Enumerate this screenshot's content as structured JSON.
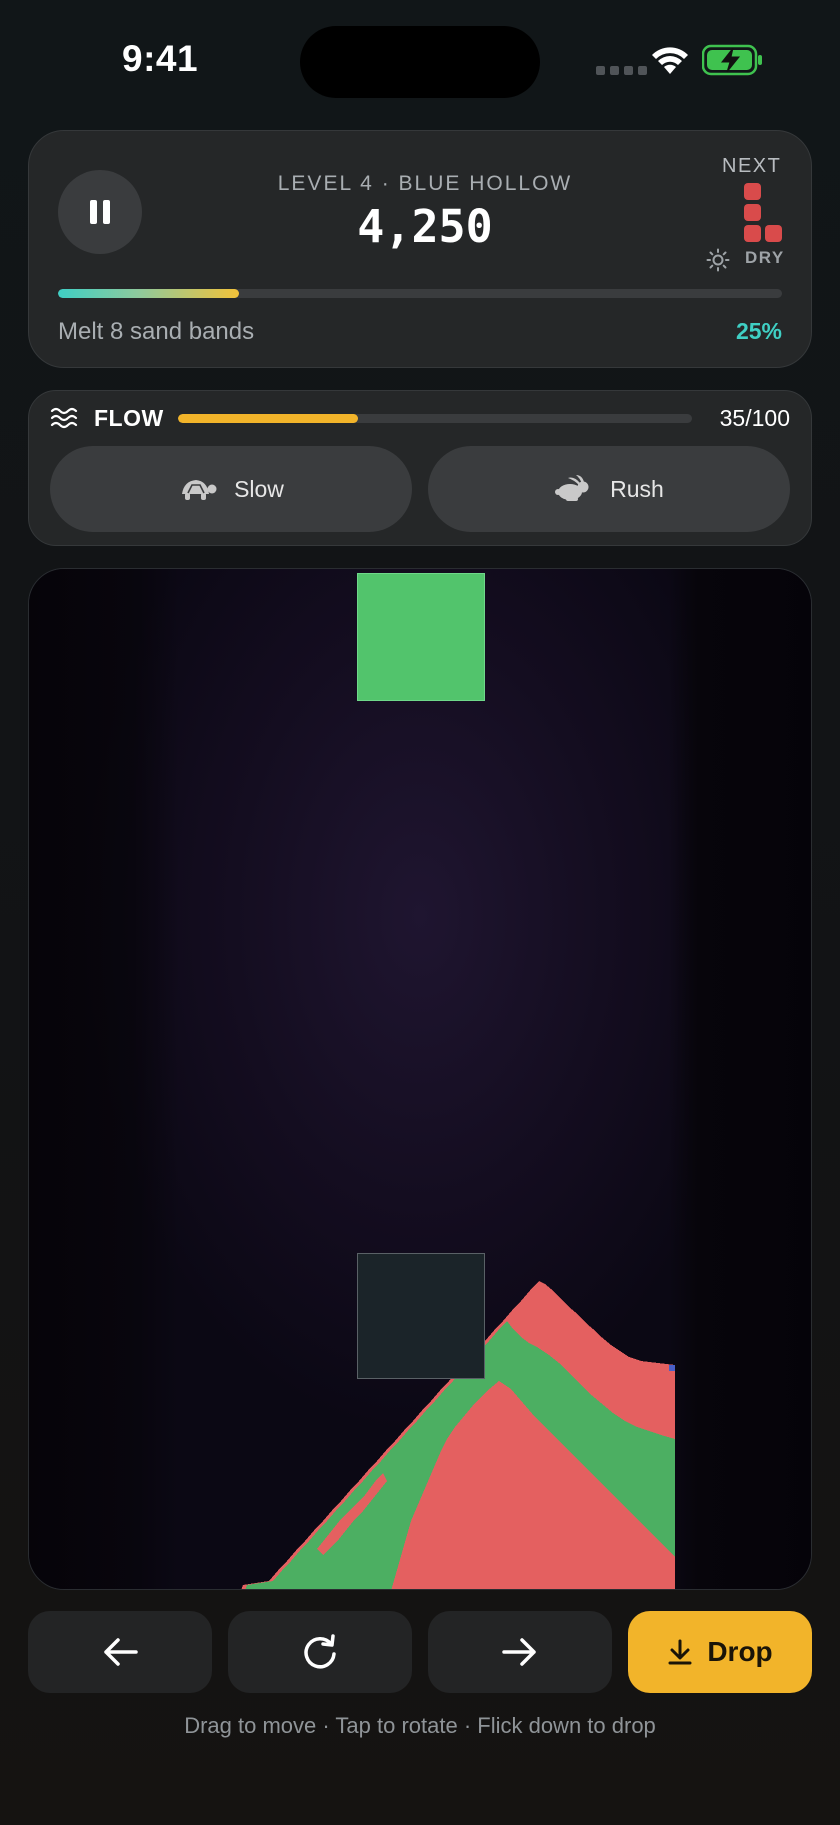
{
  "status_bar": {
    "time": "9:41"
  },
  "hud": {
    "level": "LEVEL 4 · BLUE HOLLOW",
    "score": "4,250",
    "next_label": "NEXT",
    "weather": "DRY",
    "goal": "Melt 8 sand bands",
    "goal_percent": "25%",
    "goal_progress": 0.25,
    "colors": {
      "next_piece": "#d94b4b",
      "progress_start": "#3fcfc4",
      "progress_end": "#f2c23a"
    }
  },
  "flow": {
    "label": "FLOW",
    "value_text": "35/100",
    "value": 35,
    "max": 100,
    "slow_label": "Slow",
    "rush_label": "Rush",
    "color": "#f2b42a"
  },
  "board": {
    "active_piece_color": "#52c46c",
    "sand_colors": {
      "red": "#e46060",
      "green": "#4caf62"
    }
  },
  "controls": {
    "drop_label": "Drop",
    "hint": "Drag to move · Tap to rotate · Flick down to drop"
  },
  "icons": [
    "pause-icon",
    "waves-icon",
    "turtle-icon",
    "rabbit-icon",
    "arrow-left-icon",
    "rotate-icon",
    "arrow-right-icon",
    "download-icon",
    "sun-icon",
    "wifi-icon",
    "battery-icon"
  ]
}
